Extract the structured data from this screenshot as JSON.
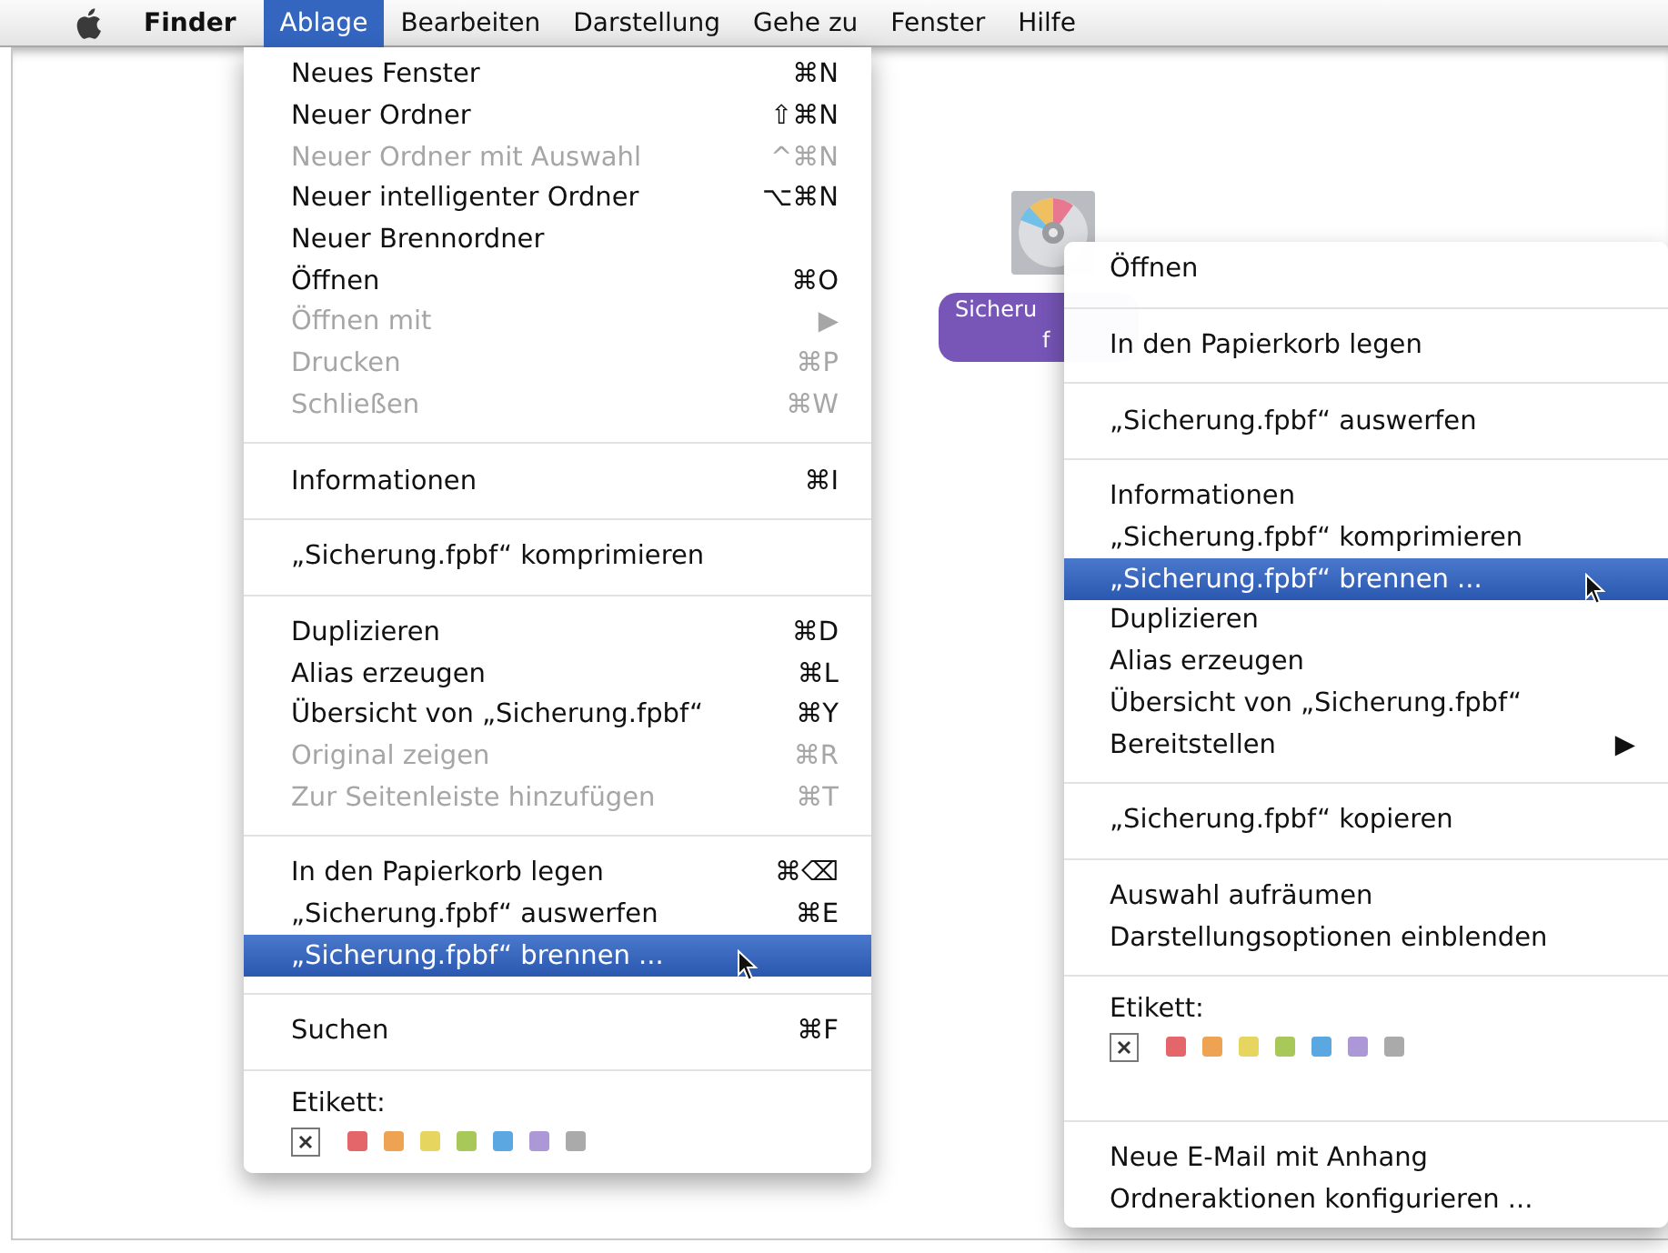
{
  "menubar": {
    "items": [
      {
        "label": "Finder",
        "selected": false,
        "kind": "app"
      },
      {
        "label": "Ablage",
        "selected": true,
        "kind": "menu"
      },
      {
        "label": "Bearbeiten",
        "selected": false,
        "kind": "menu"
      },
      {
        "label": "Darstellung",
        "selected": false,
        "kind": "menu"
      },
      {
        "label": "Gehe zu",
        "selected": false,
        "kind": "menu"
      },
      {
        "label": "Fenster",
        "selected": false,
        "kind": "menu"
      },
      {
        "label": "Hilfe",
        "selected": false,
        "kind": "menu"
      }
    ]
  },
  "ablage_menu": {
    "groups": [
      {
        "kind": "items",
        "items": [
          {
            "label": "Neues Fenster",
            "shortcut": "⌘N",
            "disabled": false,
            "selected": false
          },
          {
            "label": "Neuer Ordner",
            "shortcut": "⇧⌘N",
            "disabled": false,
            "selected": false
          },
          {
            "label": "Neuer Ordner mit Auswahl",
            "shortcut": "^⌘N",
            "disabled": true,
            "selected": false
          },
          {
            "label": "Neuer intelligenter Ordner",
            "shortcut": "⌥⌘N",
            "disabled": false,
            "selected": false
          },
          {
            "label": "Neuer Brennordner",
            "disabled": false,
            "selected": false
          },
          {
            "label": "Öffnen",
            "shortcut": "⌘O",
            "disabled": false,
            "selected": false
          },
          {
            "label": "Öffnen mit",
            "shortcut": "▶",
            "disabled": true,
            "selected": false
          },
          {
            "label": "Drucken",
            "shortcut": "⌘P",
            "disabled": true,
            "selected": false
          },
          {
            "label": "Schließen",
            "shortcut": "⌘W",
            "disabled": true,
            "selected": false
          }
        ]
      },
      {
        "kind": "items",
        "items": [
          {
            "label": "Informationen",
            "shortcut": "⌘I",
            "disabled": false,
            "selected": false
          }
        ]
      },
      {
        "kind": "items",
        "items": [
          {
            "label": "„Sicherung.fpbf“ komprimieren",
            "disabled": false,
            "selected": false
          }
        ]
      },
      {
        "kind": "items",
        "items": [
          {
            "label": "Duplizieren",
            "shortcut": "⌘D",
            "disabled": false,
            "selected": false
          },
          {
            "label": "Alias erzeugen",
            "shortcut": "⌘L",
            "disabled": false,
            "selected": false
          },
          {
            "label": "Übersicht von „Sicherung.fpbf“",
            "shortcut": "⌘Y",
            "disabled": false,
            "selected": false
          },
          {
            "label": "Original zeigen",
            "shortcut": "⌘R",
            "disabled": true,
            "selected": false
          },
          {
            "label": "Zur Seitenleiste hinzufügen",
            "shortcut": "⌘T",
            "disabled": true,
            "selected": false
          }
        ]
      },
      {
        "kind": "items",
        "items": [
          {
            "label": "In den Papierkorb legen",
            "shortcut": "⌘⌫",
            "disabled": false,
            "selected": false
          },
          {
            "label": "„Sicherung.fpbf“ auswerfen",
            "shortcut": "⌘E",
            "disabled": false,
            "selected": false
          },
          {
            "label": "„Sicherung.fpbf“ brennen ...",
            "disabled": false,
            "selected": true
          }
        ]
      },
      {
        "kind": "items",
        "items": [
          {
            "label": "Suchen",
            "shortcut": "⌘F",
            "disabled": false,
            "selected": false
          }
        ]
      },
      {
        "kind": "labels",
        "title": "Etikett:",
        "swatches": [
          {
            "kind": "none"
          },
          {
            "kind": "color",
            "color": "#e4666b"
          },
          {
            "kind": "color",
            "color": "#eea352"
          },
          {
            "kind": "color",
            "color": "#e6d55e"
          },
          {
            "kind": "color",
            "color": "#a9c85a"
          },
          {
            "kind": "color",
            "color": "#5aa7e2"
          },
          {
            "kind": "color",
            "color": "#ac98d6"
          },
          {
            "kind": "color",
            "color": "#a9aaa9"
          }
        ]
      }
    ]
  },
  "desktop_icon": {
    "label_lines": [
      "Sicheru",
      "f"
    ]
  },
  "context_menu": {
    "groups": [
      {
        "kind": "items",
        "items": [
          {
            "label": "Öffnen",
            "selected": false
          }
        ]
      },
      {
        "kind": "items",
        "items": [
          {
            "label": "In den Papierkorb legen",
            "selected": false
          }
        ]
      },
      {
        "kind": "items",
        "items": [
          {
            "label": "„Sicherung.fpbf“ auswerfen",
            "selected": false
          }
        ]
      },
      {
        "kind": "items",
        "items": [
          {
            "label": "Informationen",
            "selected": false
          },
          {
            "label": "„Sicherung.fpbf“ komprimieren",
            "selected": false
          },
          {
            "label": "„Sicherung.fpbf“ brennen ...",
            "selected": true
          },
          {
            "label": "Duplizieren",
            "selected": false
          },
          {
            "label": "Alias erzeugen",
            "selected": false
          },
          {
            "label": "Übersicht von „Sicherung.fpbf“",
            "selected": false
          },
          {
            "label": "Bereitstellen",
            "shortcut": "▶",
            "selected": false
          }
        ]
      },
      {
        "kind": "items",
        "items": [
          {
            "label": "„Sicherung.fpbf“ kopieren",
            "selected": false
          }
        ]
      },
      {
        "kind": "items",
        "items": [
          {
            "label": "Auswahl aufräumen",
            "selected": false
          },
          {
            "label": "Darstellungsoptionen einblenden",
            "selected": false
          }
        ]
      },
      {
        "kind": "labels",
        "title": "Etikett:",
        "swatches": [
          {
            "kind": "none"
          },
          {
            "kind": "color",
            "color": "#e4666b"
          },
          {
            "kind": "color",
            "color": "#eea352"
          },
          {
            "kind": "color",
            "color": "#e6d55e"
          },
          {
            "kind": "color",
            "color": "#a9c85a"
          },
          {
            "kind": "color",
            "color": "#5aa7e2"
          },
          {
            "kind": "color",
            "color": "#ac98d6"
          },
          {
            "kind": "color",
            "color": "#a9aaa9"
          }
        ]
      },
      {
        "kind": "items",
        "items": [
          {
            "label": "Neue E-Mail mit Anhang",
            "selected": false
          },
          {
            "label": "Ordneraktionen konfigurieren ...",
            "selected": false
          }
        ]
      }
    ]
  }
}
